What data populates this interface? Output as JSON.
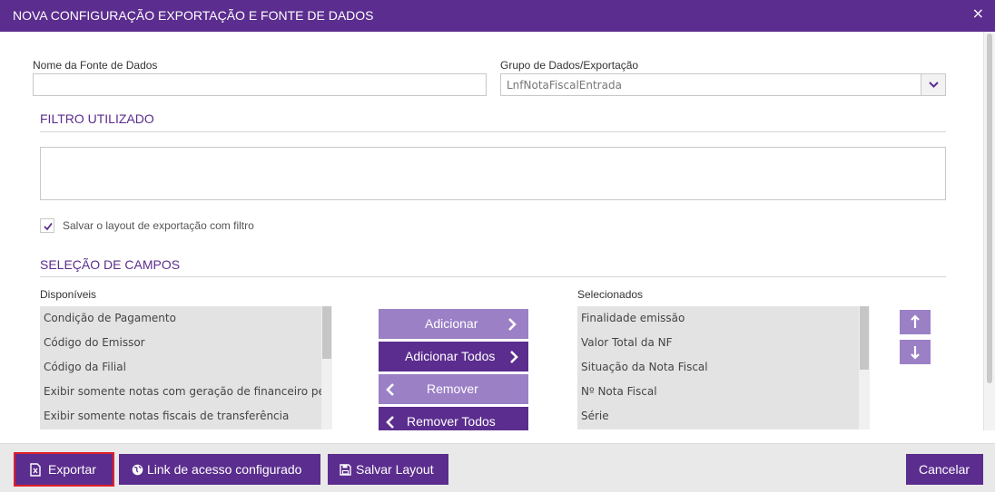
{
  "window": {
    "title": "NOVA CONFIGURAÇÃO EXPORTAÇÃO E FONTE DE DADOS",
    "close_glyph": "×"
  },
  "form": {
    "data_source_label": "Nome da Fonte de Dados",
    "data_source_value": "",
    "group_label": "Grupo de Dados/Exportação",
    "group_value": "LnfNotaFiscalEntrada"
  },
  "filter": {
    "title": "FILTRO UTILIZADO",
    "value": ""
  },
  "save_layout_with_filter": {
    "label": "Salvar o layout de exportação com filtro",
    "checked": true
  },
  "fields": {
    "title": "SELEÇÃO DE CAMPOS",
    "available_label": "Disponíveis",
    "available": [
      "Condição de Pagamento",
      "Código do Emissor",
      "Código da Filial",
      "Exibir somente notas com geração de financeiro pende",
      "Exibir somente notas fiscais de transferência"
    ],
    "selected_label": "Selecionados",
    "selected": [
      "Finalidade emissão",
      "Valor Total da NF",
      "Situação da Nota Fiscal",
      "Nº Nota Fiscal",
      "Série"
    ],
    "buttons": {
      "add": "Adicionar",
      "add_all": "Adicionar Todos",
      "remove": "Remover",
      "remove_all": "Remover Todos"
    }
  },
  "footer": {
    "export": "Exportar",
    "access_link": "Link de acesso configurado",
    "save_layout": "Salvar Layout",
    "cancel": "Cancelar"
  },
  "colors": {
    "brand": "#5b2d8e",
    "brand_light": "#9b80c6",
    "highlight_border": "#e0202a"
  }
}
